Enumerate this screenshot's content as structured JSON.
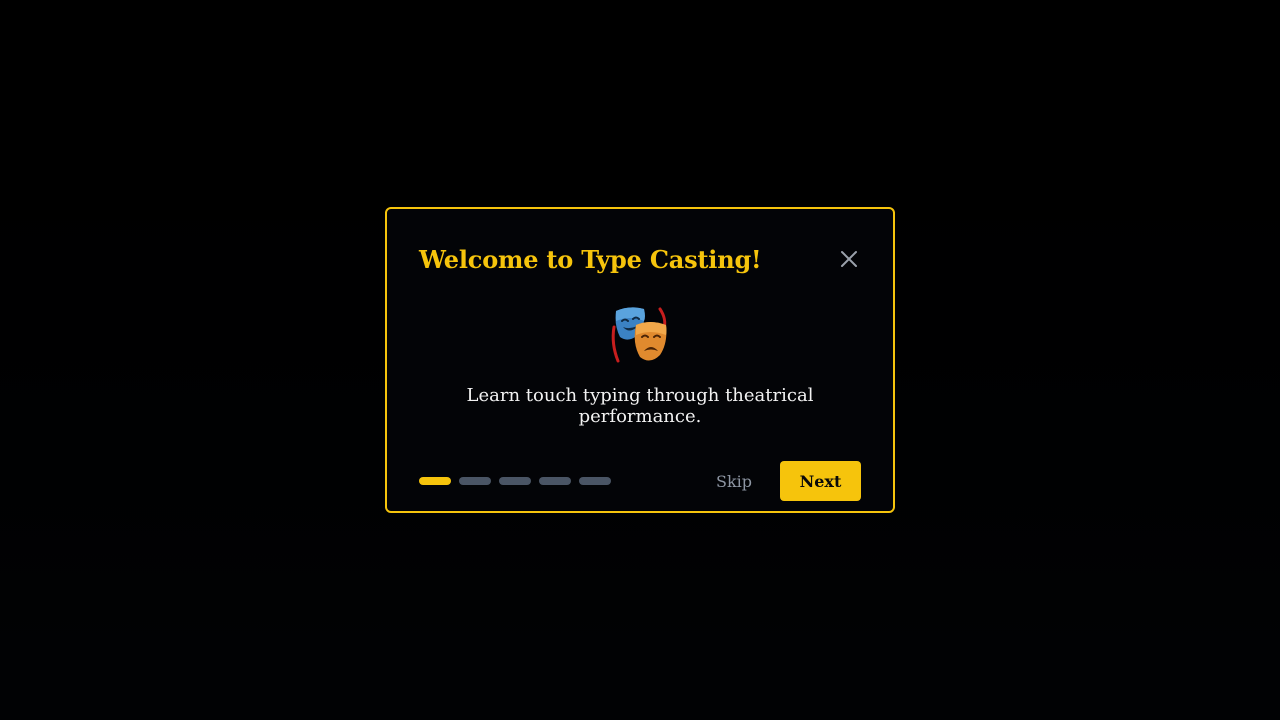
{
  "modal": {
    "title": "Welcome to Type Casting!",
    "icon": "theater-masks-icon",
    "description": "Learn touch typing through theatrical performance.",
    "progress": {
      "total_steps": 5,
      "current_step": 1
    },
    "skip_label": "Skip",
    "next_label": "Next"
  },
  "colors": {
    "accent": "#f6c40c",
    "inactive_dot": "#4a5565",
    "muted_text": "#8e96a3",
    "background": "#030407"
  }
}
